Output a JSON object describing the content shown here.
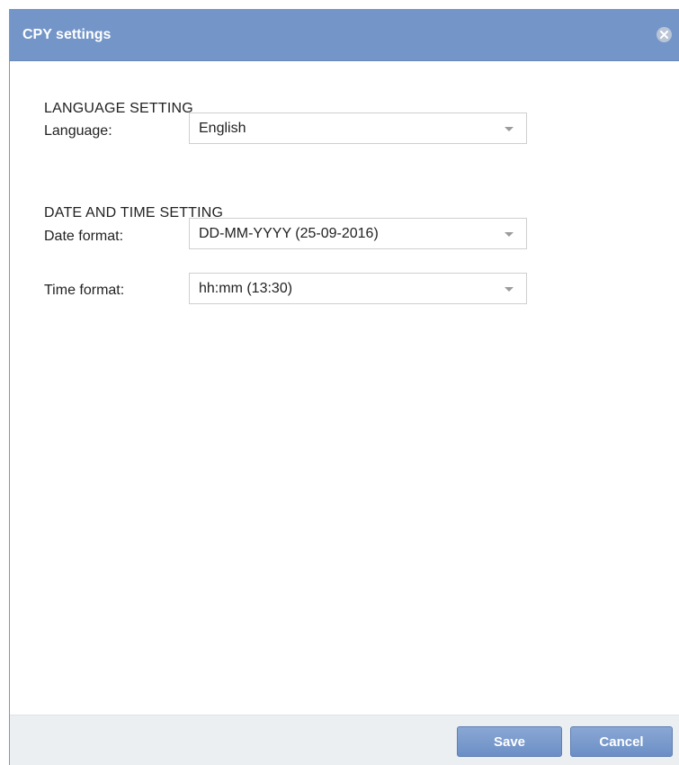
{
  "dialog": {
    "title": "CPY settings",
    "close_icon": "close-circle-icon"
  },
  "language_section": {
    "heading": "LANGUAGE SETTING",
    "language_label": "Language:",
    "language_value": "English"
  },
  "datetime_section": {
    "heading": "DATE AND TIME SETTING",
    "date_label": "Date format:",
    "date_value": "DD-MM-YYYY (25-09-2016)",
    "time_label": "Time format:",
    "time_value": "hh:mm (13:30)"
  },
  "footer": {
    "save_label": "Save",
    "cancel_label": "Cancel"
  },
  "colors": {
    "titlebar": "#7395c8",
    "button": "#7b9bcd",
    "footer": "#eceff2"
  }
}
